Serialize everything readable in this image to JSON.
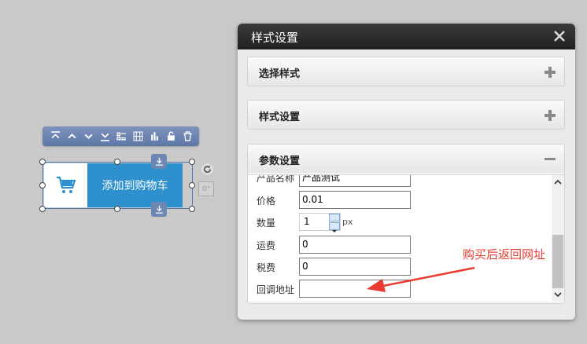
{
  "toolbar": {
    "icons": [
      "align-top-icon",
      "move-up-icon",
      "move-down-icon",
      "align-bottom-icon",
      "list-icon",
      "grid-icon",
      "chart-icon",
      "unlock-icon",
      "trash-icon"
    ]
  },
  "widget": {
    "label": "添加到购物车",
    "angle": "0°"
  },
  "dialog": {
    "title": "样式设置",
    "sections": [
      {
        "title": "选择样式",
        "state": "collapsed"
      },
      {
        "title": "样式设置",
        "state": "collapsed"
      },
      {
        "title": "参数设置",
        "state": "expanded"
      }
    ],
    "params": {
      "product_name_label": "产品名称",
      "product_name_value": "产品测试",
      "price_label": "价格",
      "price_value": "0.01",
      "quantity_label": "数量",
      "quantity_value": "1",
      "quantity_unit": "px",
      "shipping_label": "运费",
      "shipping_value": "0",
      "tax_label": "税费",
      "tax_value": "0",
      "callback_label": "回调地址",
      "callback_value": ""
    }
  },
  "annotation": {
    "text": "购买后返回网址",
    "color": "#e83a2e"
  },
  "colors": {
    "accent": "#2e90cc",
    "toolbar": "#6b84b0",
    "dialog_header": "#2c2c2c"
  }
}
